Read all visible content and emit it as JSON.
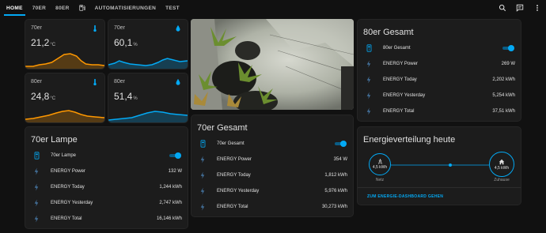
{
  "nav": {
    "tabs": [
      "HOME",
      "70ER",
      "80ER",
      "AUTOMATISIERUNGEN",
      "TEST"
    ]
  },
  "colors": {
    "accent": "#03a9f4",
    "temp_graph": "#ff9800",
    "humidity_graph": "#03a9f4"
  },
  "sensors": [
    {
      "name": "70er",
      "value": "21,2",
      "unit": "°C",
      "icon": "thermometer-icon"
    },
    {
      "name": "70er",
      "value": "60,1",
      "unit": "%",
      "icon": "water-drop-icon"
    },
    {
      "name": "80er",
      "value": "24,8",
      "unit": "°C",
      "icon": "thermometer-icon"
    },
    {
      "name": "80er",
      "value": "51,4",
      "unit": "%",
      "icon": "water-drop-icon"
    }
  ],
  "lamp70": {
    "title": "70er Lampe",
    "switch_label": "70er Lampe",
    "switch_on": true,
    "rows": [
      {
        "label": "ENERGY Power",
        "value": "132 W"
      },
      {
        "label": "ENERGY Today",
        "value": "1,244 kWh"
      },
      {
        "label": "ENERGY Yesterday",
        "value": "2,747 kWh"
      },
      {
        "label": "ENERGY Total",
        "value": "16,146 kWh"
      }
    ]
  },
  "total70": {
    "title": "70er Gesamt",
    "switch_label": "70er Gesamt",
    "switch_on": true,
    "rows": [
      {
        "label": "ENERGY Power",
        "value": "354 W"
      },
      {
        "label": "ENERGY Today",
        "value": "1,812 kWh"
      },
      {
        "label": "ENERGY Yesterday",
        "value": "5,976 kWh"
      },
      {
        "label": "ENERGY Total",
        "value": "30,273 kWh"
      }
    ]
  },
  "total80": {
    "title": "80er Gesamt",
    "switch_label": "80er Gesamt",
    "switch_on": true,
    "rows": [
      {
        "label": "ENERGY Power",
        "value": "269 W"
      },
      {
        "label": "ENERGY Today",
        "value": "2,202 kWh"
      },
      {
        "label": "ENERGY Yesterday",
        "value": "5,254 kWh"
      },
      {
        "label": "ENERGY Total",
        "value": "37,51 kWh"
      }
    ]
  },
  "energy_dist": {
    "title": "Energieverteilung heute",
    "grid_value": "4,5 kWh",
    "grid_label": "Netz",
    "home_value": "4,5 kWh",
    "home_label": "Zuhause",
    "link": "ZUM ENERGIE-DASHBOARD GEHEN"
  }
}
